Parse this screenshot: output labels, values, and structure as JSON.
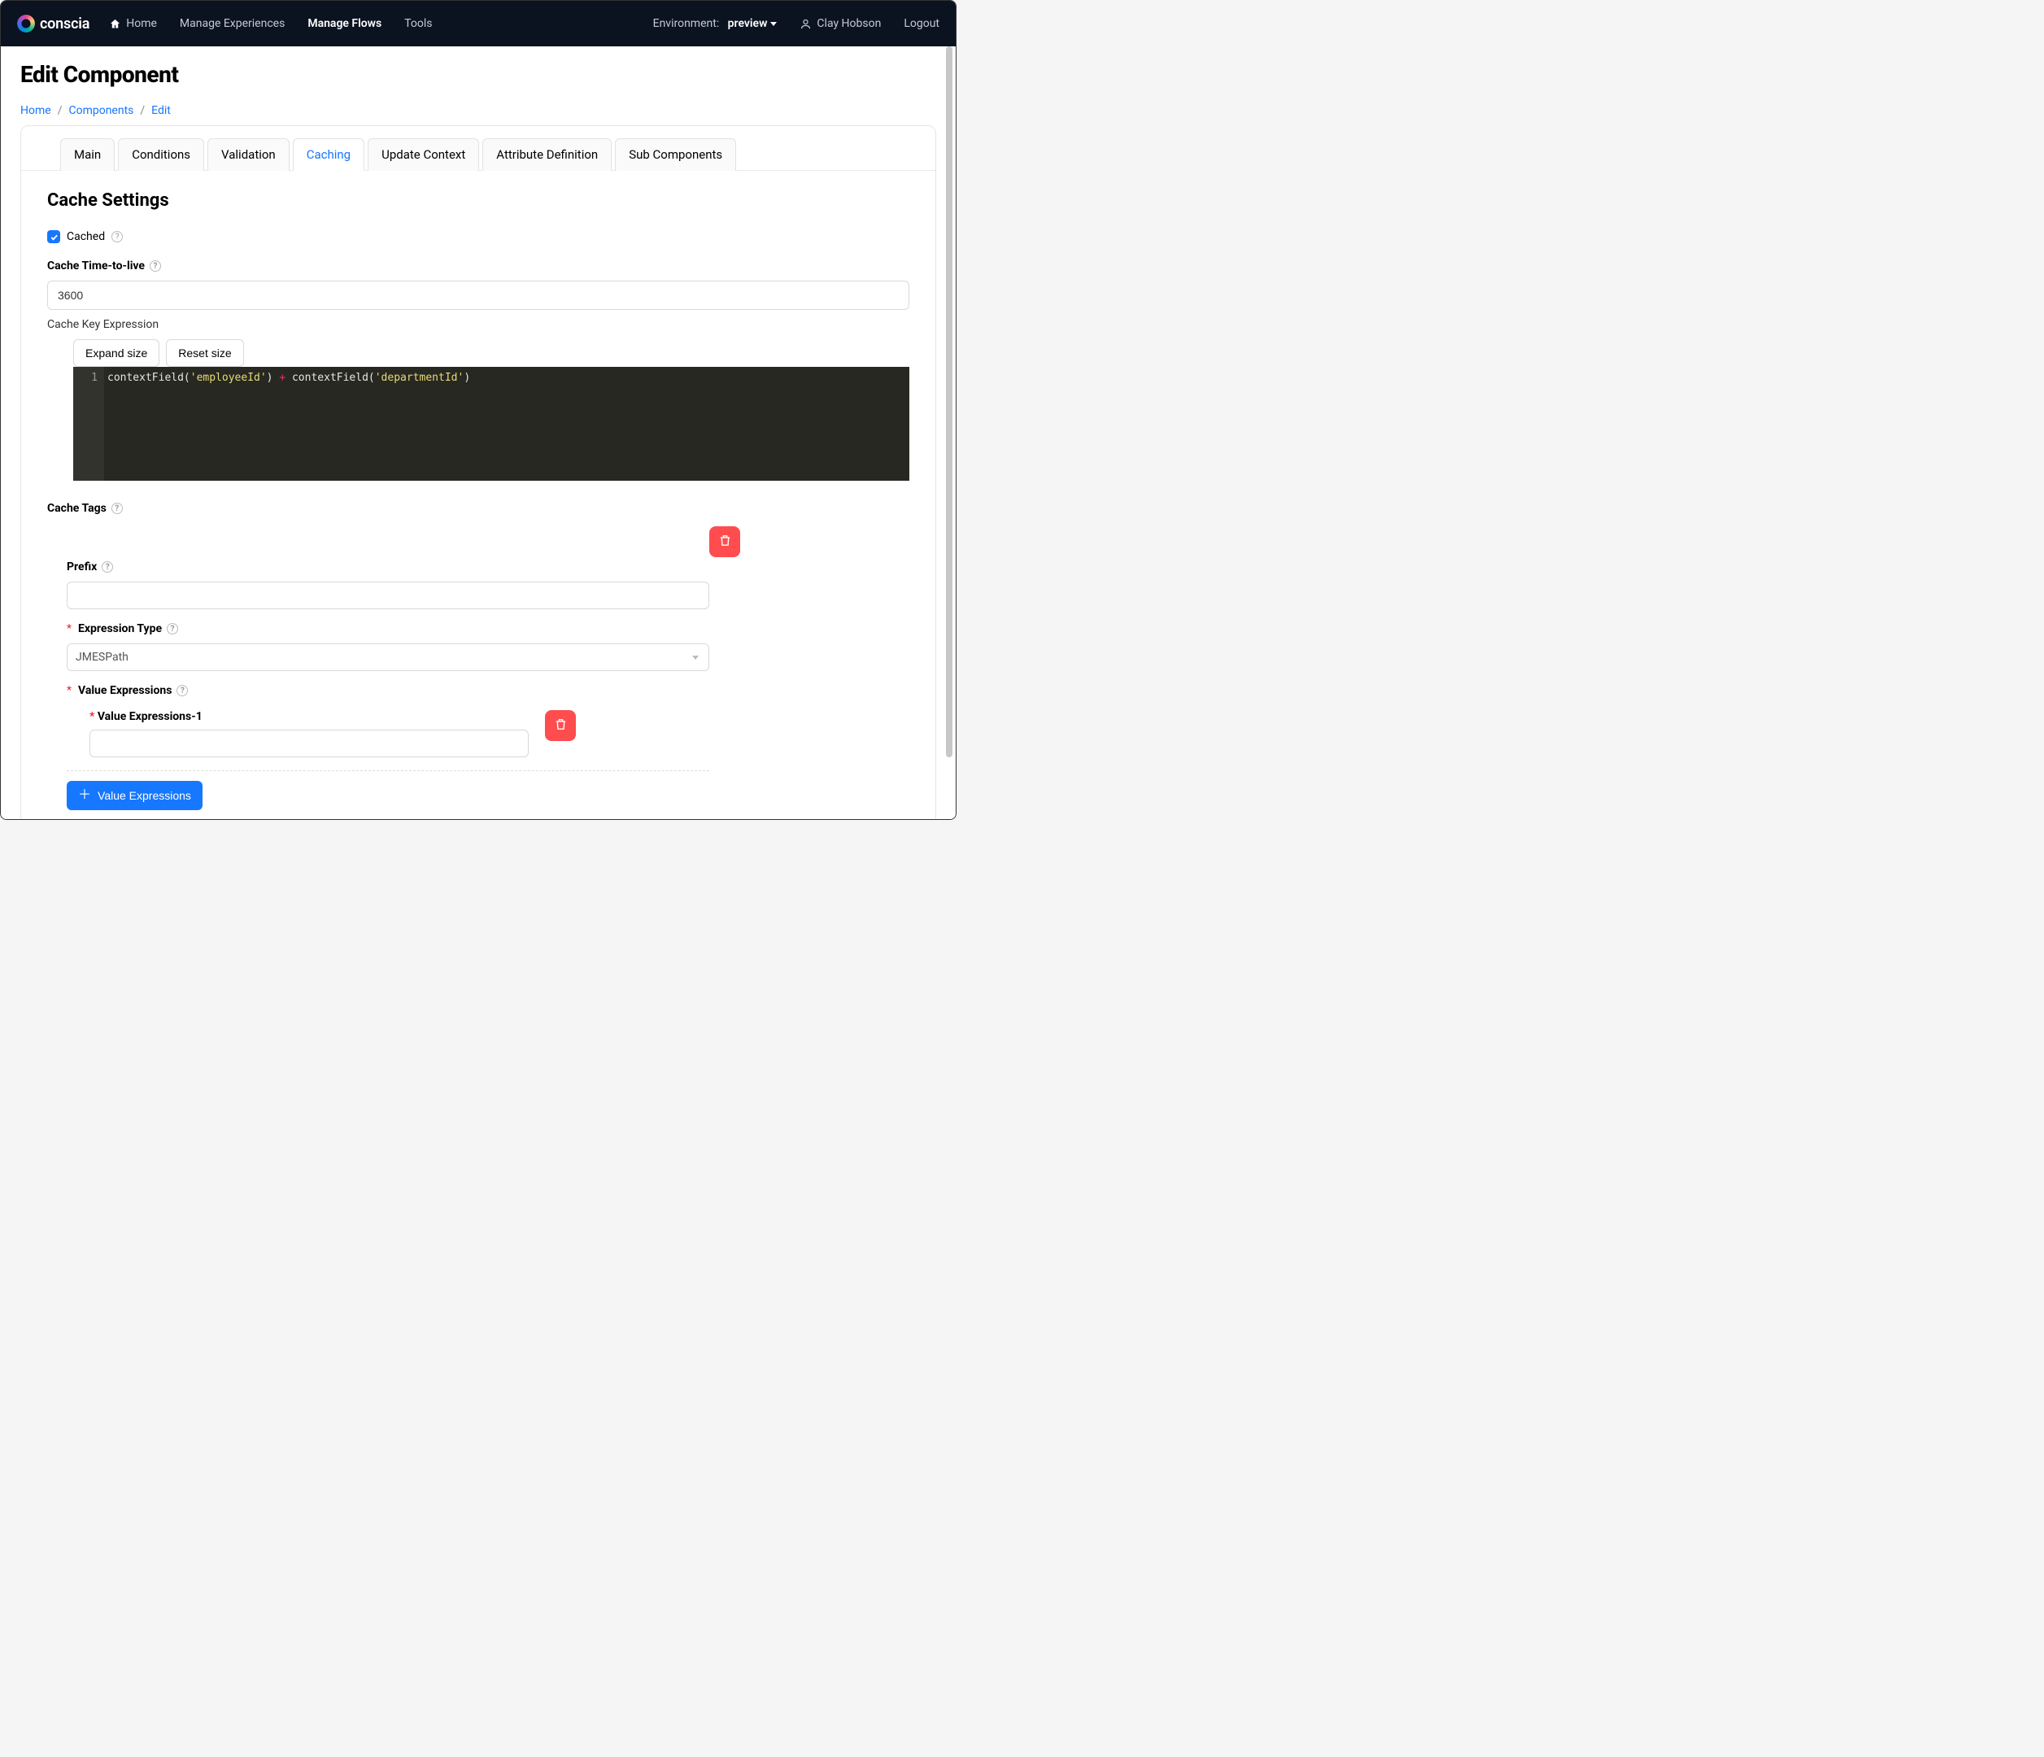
{
  "brand": {
    "name": "conscia"
  },
  "nav": {
    "home": "Home",
    "manage_experiences": "Manage Experiences",
    "manage_flows": "Manage Flows",
    "tools": "Tools",
    "env_label": "Environment:",
    "env_value": "preview",
    "user": "Clay Hobson",
    "logout": "Logout"
  },
  "page": {
    "title": "Edit Component",
    "breadcrumbs": {
      "home": "Home",
      "components": "Components",
      "edit": "Edit"
    }
  },
  "tabs": {
    "main": "Main",
    "conditions": "Conditions",
    "validation": "Validation",
    "caching": "Caching",
    "update_context": "Update Context",
    "attribute_definition": "Attribute Definition",
    "sub_components": "Sub Components"
  },
  "caching": {
    "section_title": "Cache Settings",
    "cached_label": "Cached",
    "ttl_label": "Cache Time-to-live",
    "ttl_value": "3600",
    "key_expr_label": "Cache Key Expression",
    "expand_btn": "Expand size",
    "reset_btn": "Reset size",
    "code": {
      "line_number": "1",
      "tokens": {
        "fn1": "contextField",
        "open": "(",
        "str1": "'employeeId'",
        "close": ")",
        "plus": " + ",
        "fn2": "contextField",
        "str2": "'departmentId'"
      }
    },
    "tags_label": "Cache Tags",
    "prefix_label": "Prefix",
    "prefix_value": "",
    "expr_type_label": "Expression Type",
    "expr_type_value": "JMESPath",
    "value_exprs_label": "Value Expressions",
    "value_expr_item_label": "Value Expressions-1",
    "value_expr_item_value": "",
    "add_btn": "Value Expressions"
  }
}
